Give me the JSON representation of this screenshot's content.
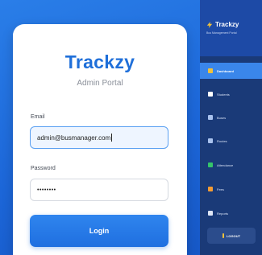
{
  "login": {
    "brand": "Trackzy",
    "subtitle": "Admin Portal",
    "email_label": "Email",
    "email_value": "admin@busmanager.com",
    "password_label": "Password",
    "password_value": "••••••••",
    "login_button": "Login"
  },
  "sidebar": {
    "title": "Trackzy",
    "subtitle": "Bus Management Portal",
    "items": [
      {
        "label": "Dashboard",
        "icon": "dashboard-icon",
        "color": "#f2c23a",
        "active": true
      },
      {
        "label": "Students",
        "icon": "students-icon",
        "color": "#ffffff"
      },
      {
        "label": "Buses",
        "icon": "bus-icon",
        "color": "#a9c2ee"
      },
      {
        "label": "Routes",
        "icon": "routes-icon",
        "color": "#a9c2ee"
      },
      {
        "label": "Attendance",
        "icon": "attendance-icon",
        "color": "#35c46a"
      },
      {
        "label": "Fees",
        "icon": "fees-icon",
        "color": "#f39c34"
      },
      {
        "label": "Reports",
        "icon": "reports-icon",
        "color": "#dfe6f5"
      }
    ],
    "logout": "LOGOUT"
  },
  "colors": {
    "background": "#1c66d8",
    "brand": "#1f6fd9",
    "sidebar": "#1a3a78",
    "active_item": "#3a86ea",
    "focus_border": "#5aa0f2"
  }
}
